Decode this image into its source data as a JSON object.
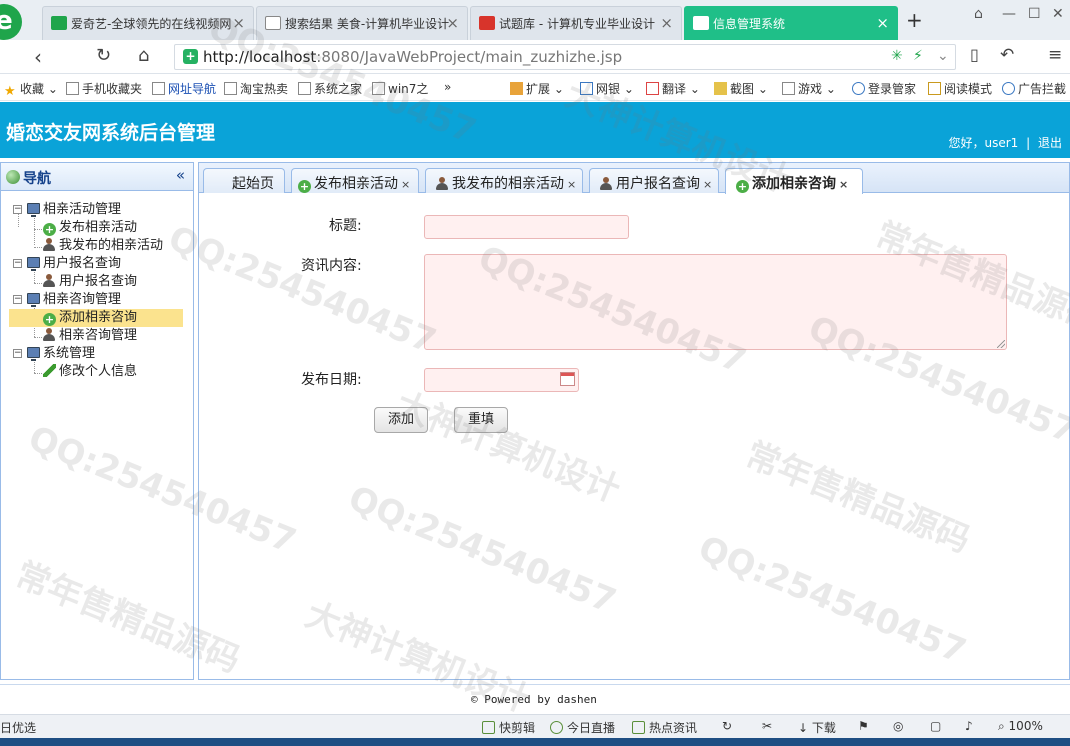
{
  "browser": {
    "tabs": [
      {
        "title": "爱奇艺-全球领先的在线视频网",
        "fav_color": "#1fa54b"
      },
      {
        "title": "搜索结果 美食-计算机毕业设计",
        "fav_color": "#e9eef3"
      },
      {
        "title": "试题库 - 计算机专业毕业设计",
        "fav_color": "#d8342b"
      },
      {
        "title": "信息管理系统",
        "fav_color": "#1fbf88"
      }
    ],
    "logo": "e",
    "new_tab": "+",
    "url_host": "http://localhost",
    "url_rest": ":8080/JavaWebProject/main_zuzhizhe.jsp",
    "bookmarks": [
      {
        "label": "收藏",
        "icon": "star-icon"
      },
      {
        "label": "手机收藏夹",
        "icon": "page-icon"
      },
      {
        "label": "网址导航",
        "icon": "page-icon"
      },
      {
        "label": "淘宝热卖",
        "icon": "page-icon"
      },
      {
        "label": "系统之家",
        "icon": "page-icon"
      },
      {
        "label": "win7之",
        "icon": "page-icon"
      },
      {
        "label": "»",
        "icon": ""
      },
      {
        "label": "扩展",
        "icon": "grid-icon"
      },
      {
        "label": "网银",
        "icon": "bank-icon"
      },
      {
        "label": "翻译",
        "icon": "translate-icon"
      },
      {
        "label": "截图",
        "icon": "scissors-icon"
      },
      {
        "label": "游戏",
        "icon": "game-icon"
      },
      {
        "label": "登录管家",
        "icon": "key-icon"
      },
      {
        "label": "阅读模式",
        "icon": "book-icon"
      },
      {
        "label": "广告拦截",
        "icon": "block-icon"
      }
    ]
  },
  "app": {
    "title": "婚恋交友网系统后台管理",
    "greeting": "您好，user1",
    "separator": "|",
    "logout": "退出"
  },
  "nav": {
    "title": "导航",
    "collapse": "«",
    "items": [
      {
        "label": "相亲活动管理",
        "type": "group"
      },
      {
        "label": "发布相亲活动",
        "type": "add"
      },
      {
        "label": "我发布的相亲活动",
        "type": "person"
      },
      {
        "label": "用户报名查询",
        "type": "group"
      },
      {
        "label": "用户报名查询",
        "type": "person"
      },
      {
        "label": "相亲咨询管理",
        "type": "group"
      },
      {
        "label": "添加相亲咨询",
        "type": "add"
      },
      {
        "label": "相亲咨询管理",
        "type": "person"
      },
      {
        "label": "系统管理",
        "type": "group"
      },
      {
        "label": "修改个人信息",
        "type": "edit"
      }
    ]
  },
  "tabs": [
    {
      "label": "起始页",
      "icon": "",
      "closable": false
    },
    {
      "label": "发布相亲活动",
      "icon": "add",
      "closable": true
    },
    {
      "label": "我发布的相亲活动",
      "icon": "person",
      "closable": true
    },
    {
      "label": "用户报名查询",
      "icon": "person",
      "closable": true
    },
    {
      "label": "添加相亲咨询",
      "icon": "add",
      "closable": true
    }
  ],
  "tab_close": "×",
  "form": {
    "title_label": "标题:",
    "title_value": "",
    "content_label": "资讯内容:",
    "content_value": "",
    "date_label": "发布日期:",
    "date_value": "",
    "submit": "添加",
    "reset": "重填"
  },
  "footer": "© Powered by dashen",
  "statusbar": [
    {
      "label": "日优选"
    },
    {
      "label": "快剪辑"
    },
    {
      "label": "今日直播"
    },
    {
      "label": "热点资讯"
    },
    {
      "label": "下载"
    },
    {
      "label": "100%"
    }
  ],
  "watermarks": [
    "QQ:254540457",
    "大神计算机设计",
    "常年售精品源码"
  ]
}
